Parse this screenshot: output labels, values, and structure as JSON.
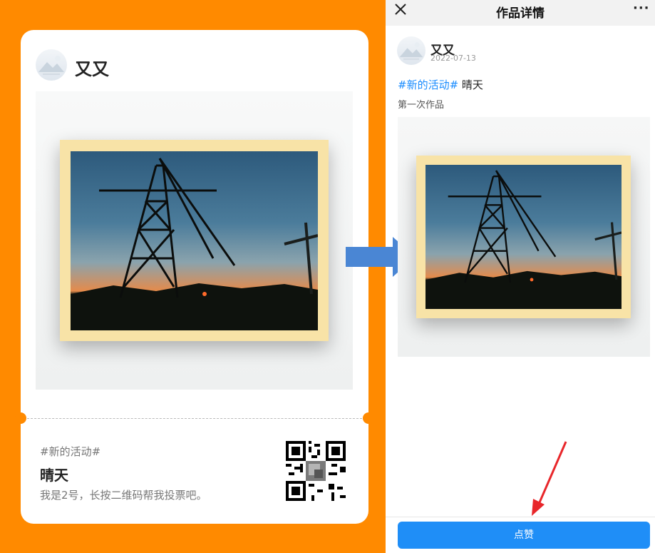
{
  "poster": {
    "username": "又又",
    "tag": "#新的活动#",
    "title": "晴天",
    "description": "我是2号，长按二维码帮我投票吧。"
  },
  "app": {
    "page_title": "作品详情",
    "close_icon": "close-icon",
    "more_icon": "more-icon",
    "author": {
      "name": "又又",
      "date": "2022-07-13"
    },
    "hashtag": "#新的活动#",
    "title": "晴天",
    "description": "第一次作品",
    "like_button_label": "点赞"
  },
  "colors": {
    "poster_background": "#ff8a00",
    "hashtag_blue": "#1a8cff",
    "like_button": "#1f8ef7",
    "transition_arrow": "#4a86d4",
    "annotation_arrow": "#e8262a"
  }
}
